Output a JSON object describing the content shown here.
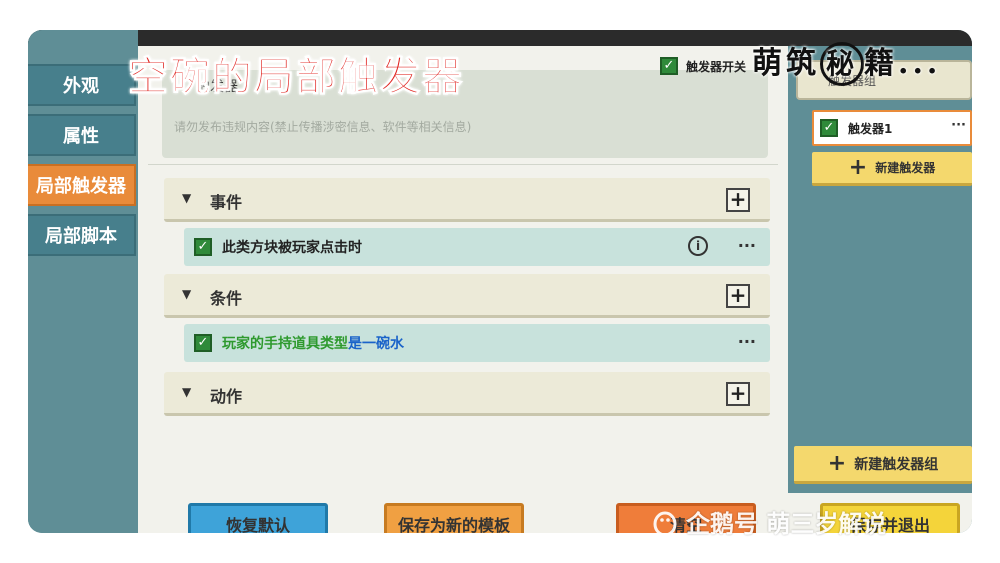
{
  "video_title": "空碗的局部触发器",
  "channel_logo": {
    "part1": "萌筑",
    "circled": "秘",
    "part2": "籍..."
  },
  "watermark": {
    "text": "企鹅号 萌三岁解说"
  },
  "left_tabs": [
    {
      "label": "外观",
      "active": false
    },
    {
      "label": "属性",
      "active": false
    },
    {
      "label": "局部触发器",
      "active": true
    },
    {
      "label": "局部脚本",
      "active": false
    }
  ],
  "description": {
    "label": "触发器",
    "placeholder": "请勿发布违规内容(禁止传播涉密信息、软件等相关信息)"
  },
  "enable_trigger": {
    "label": "触发器开关",
    "checked": true
  },
  "sections": {
    "event": {
      "title": "事件",
      "item": {
        "text": "此类方块被玩家点击时"
      }
    },
    "condition": {
      "title": "条件",
      "item": {
        "part1": "玩家的手持道具类型",
        "part2": "是一碗水"
      }
    },
    "action": {
      "title": "动作"
    }
  },
  "right_panel": {
    "top_button": "触发器组",
    "trigger_item": "触发器1",
    "new_trigger": "新建触发器",
    "new_group": "新建触发器组"
  },
  "bottom_buttons": {
    "restore": "恢复默认",
    "save_template": "保存为新的模板",
    "clear": "清空",
    "save": "保存并退出"
  },
  "icons": {
    "check": "✓",
    "plus": "+",
    "more": "···",
    "info": "i",
    "caret": "▼"
  },
  "colors": {
    "accent_orange": "#e98b3a",
    "teal": "#5f8e96",
    "checkbox_green": "#2f8a3a",
    "title_red": "#e0231f"
  }
}
